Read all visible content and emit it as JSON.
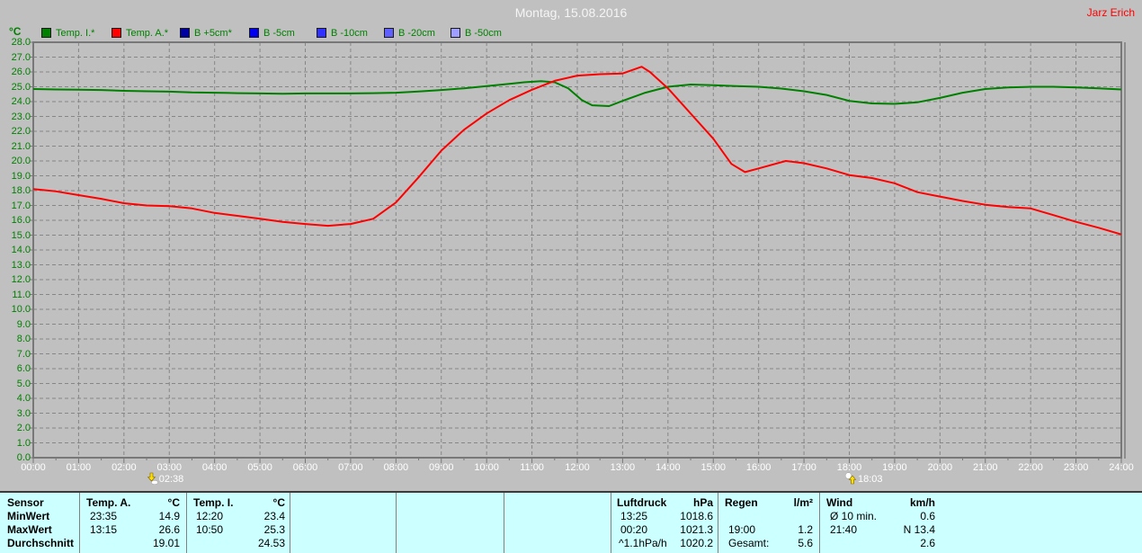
{
  "header": {
    "title": "Montag, 15.08.2016",
    "author": "Jarz Erich"
  },
  "legend": {
    "unit": "°C",
    "items": [
      {
        "label": "Temp. I.*",
        "color": "#008000"
      },
      {
        "label": "Temp. A.*",
        "color": "#FF0000"
      },
      {
        "label": "B +5cm*",
        "color": "#0000A0"
      },
      {
        "label": "B -5cm",
        "color": "#0000F0"
      },
      {
        "label": "B -10cm",
        "color": "#3030FF"
      },
      {
        "label": "B -20cm",
        "color": "#6060FF"
      },
      {
        "label": "B -50cm",
        "color": "#9F9FFF"
      }
    ]
  },
  "chart_data": {
    "type": "line",
    "title": "Montag, 15.08.2016",
    "ylabel": "°C",
    "xlabel": "",
    "ylim": [
      0,
      28
    ],
    "xlim_hours": [
      0,
      24
    ],
    "grid": true,
    "legend_position": "top",
    "ytick_labels": [
      "28.0",
      "27.0",
      "26.0",
      "25.0",
      "24.0",
      "23.0",
      "22.0",
      "21.0",
      "20.0",
      "19.0",
      "18.0",
      "17.0",
      "16.0",
      "15.0",
      "14.0",
      "13.0",
      "12.0",
      "11.0",
      "10.0",
      "9.0",
      "8.0",
      "7.0",
      "6.0",
      "5.0",
      "4.0",
      "3.0",
      "2.0",
      "1.0",
      "0.0"
    ],
    "xtick_labels": [
      "00:00",
      "01:00",
      "02:00",
      "03:00",
      "04:00",
      "05:00",
      "06:00",
      "07:00",
      "08:00",
      "09:00",
      "10:00",
      "11:00",
      "12:00",
      "13:00",
      "14:00",
      "15:00",
      "16:00",
      "17:00",
      "18:00",
      "19:00",
      "20:00",
      "21:00",
      "22:00",
      "23:00",
      "24:00"
    ],
    "series": [
      {
        "name": "Temp. I.*",
        "color": "#008000",
        "x": [
          0,
          0.5,
          1,
          1.5,
          2,
          2.5,
          3,
          3.5,
          4,
          4.5,
          5,
          5.5,
          6,
          6.5,
          7,
          7.5,
          8,
          8.5,
          9,
          9.5,
          10,
          10.5,
          10.83,
          11.2,
          11.5,
          11.8,
          12.1,
          12.33,
          12.7,
          13,
          13.5,
          14,
          14.5,
          15,
          15.5,
          16,
          16.5,
          17,
          17.5,
          18,
          18.5,
          19,
          19.5,
          20,
          20.5,
          21,
          21.5,
          22,
          22.5,
          23,
          23.5,
          24
        ],
        "y": [
          24.85,
          24.82,
          24.8,
          24.78,
          24.73,
          24.7,
          24.67,
          24.62,
          24.6,
          24.57,
          24.55,
          24.53,
          24.55,
          24.55,
          24.55,
          24.57,
          24.6,
          24.68,
          24.78,
          24.9,
          25.05,
          25.2,
          25.3,
          25.38,
          25.3,
          24.9,
          24.1,
          23.75,
          23.7,
          24.05,
          24.6,
          25.0,
          25.15,
          25.1,
          25.05,
          25.0,
          24.88,
          24.7,
          24.45,
          24.05,
          23.88,
          23.85,
          23.95,
          24.25,
          24.6,
          24.85,
          24.95,
          25.0,
          25.0,
          24.95,
          24.9,
          24.82
        ]
      },
      {
        "name": "Temp. A.*",
        "color": "#FF0000",
        "x": [
          0,
          0.5,
          1,
          1.5,
          2,
          2.5,
          3,
          3.5,
          4,
          4.5,
          5,
          5.5,
          6,
          6.5,
          7,
          7.5,
          8,
          8.5,
          9,
          9.5,
          10,
          10.5,
          11,
          11.5,
          12,
          12.5,
          13,
          13.42,
          13.6,
          14,
          14.5,
          15,
          15.4,
          15.7,
          16,
          16.6,
          17,
          17.5,
          18,
          18.5,
          19,
          19.5,
          20,
          20.5,
          21,
          21.5,
          22,
          22.5,
          23,
          23.5,
          24
        ],
        "y": [
          18.1,
          17.95,
          17.7,
          17.45,
          17.15,
          17.0,
          16.95,
          16.8,
          16.5,
          16.3,
          16.1,
          15.9,
          15.75,
          15.63,
          15.75,
          16.1,
          17.2,
          18.9,
          20.7,
          22.1,
          23.2,
          24.1,
          24.8,
          25.4,
          25.75,
          25.85,
          25.9,
          26.35,
          26.0,
          24.9,
          23.2,
          21.5,
          19.8,
          19.25,
          19.5,
          20.0,
          19.85,
          19.5,
          19.05,
          18.85,
          18.5,
          17.9,
          17.6,
          17.3,
          17.05,
          16.9,
          16.8,
          16.35,
          15.9,
          15.5,
          15.05
        ]
      },
      {
        "name": "B +5cm*",
        "color": "#0000A0",
        "x": [],
        "y": []
      },
      {
        "name": "B -5cm",
        "color": "#0000F0",
        "x": [],
        "y": []
      },
      {
        "name": "B -10cm",
        "color": "#3030FF",
        "x": [],
        "y": []
      },
      {
        "name": "B -20cm",
        "color": "#6060FF",
        "x": [],
        "y": []
      },
      {
        "name": "B -50cm",
        "color": "#9F9FFF",
        "x": [],
        "y": []
      }
    ]
  },
  "markers": [
    {
      "id": "sunrise",
      "time": "02:38",
      "hour": 2.633
    },
    {
      "id": "sunset",
      "time": "18:03",
      "hour": 18.05
    }
  ],
  "table": {
    "row_labels": [
      "Sensor",
      "MinWert",
      "MaxWert",
      "Durchschnitt"
    ],
    "temp_a": {
      "header": "Temp. A.",
      "unit": "°C",
      "rows": [
        [
          "23:35",
          "14.9"
        ],
        [
          "13:15",
          "26.6"
        ],
        [
          "",
          "19.01"
        ]
      ]
    },
    "temp_i": {
      "header": "Temp. I.",
      "unit": "°C",
      "rows": [
        [
          "12:20",
          "23.4"
        ],
        [
          "10:50",
          "25.3"
        ],
        [
          "",
          "24.53"
        ]
      ]
    },
    "luftdruck": {
      "header": "Luftdruck",
      "unit": "hPa",
      "rows": [
        [
          "13:25",
          "1018.6"
        ],
        [
          "00:20",
          "1021.3"
        ],
        [
          "^1.1hPa/h",
          "1020.2"
        ]
      ]
    },
    "regen": {
      "header": "Regen",
      "unit": "l/m²",
      "rows": [
        [
          "",
          ""
        ],
        [
          "19:00",
          "1.2"
        ],
        [
          "Gesamt:",
          "5.6"
        ]
      ]
    },
    "wind": {
      "header": "Wind",
      "unit": "km/h",
      "rows": [
        [
          "Ø 10 min.",
          "0.6"
        ],
        [
          "21:40",
          "N 13.4"
        ],
        [
          "",
          "2.6"
        ]
      ]
    }
  }
}
